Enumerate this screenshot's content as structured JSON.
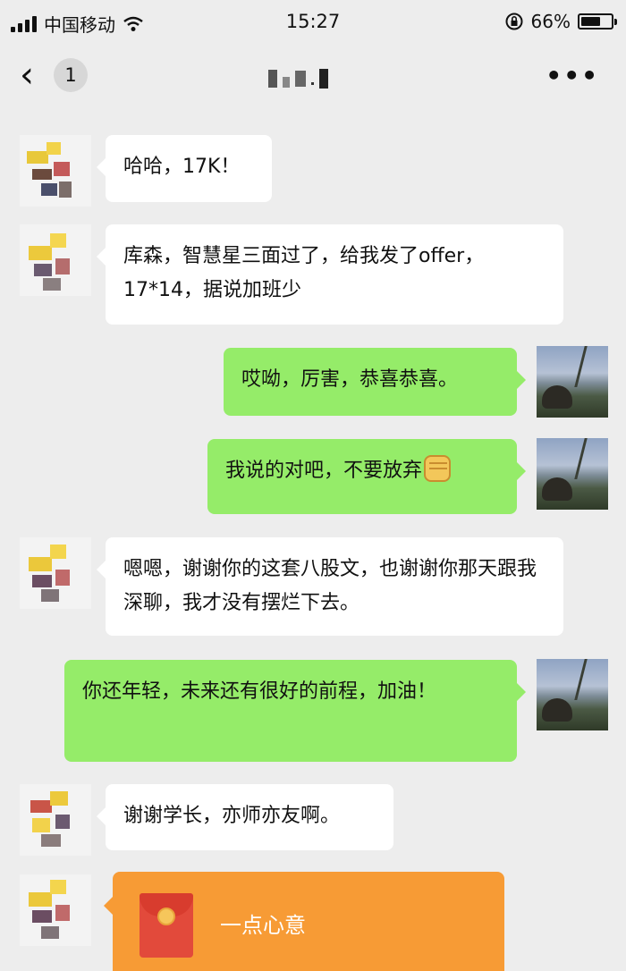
{
  "status_bar": {
    "carrier": "中国移动",
    "time": "15:27",
    "battery_text": "66%",
    "battery_level": 0.66,
    "icons": [
      "signal-icon",
      "wifi-icon",
      "rotation-lock-icon",
      "battery-icon"
    ]
  },
  "nav": {
    "back_icon": "chevron-left-icon",
    "unread_count": "1",
    "title": "",
    "more_icon": "more-dots-icon"
  },
  "messages": [
    {
      "sender": "them",
      "text": "哈哈，17K！"
    },
    {
      "sender": "them",
      "text": "库森，智慧星三面过了，给我发了offer，17*14，据说加班少"
    },
    {
      "sender": "me",
      "text": "哎呦，厉害，恭喜恭喜。"
    },
    {
      "sender": "me",
      "text": "我说的对吧，不要放弃",
      "emoji": "fist-emoji"
    },
    {
      "sender": "them",
      "text": "嗯嗯，谢谢你的这套八股文，也谢谢你那天跟我深聊，我才没有摆烂下去。"
    },
    {
      "sender": "me",
      "text": "你还年轻，未来还有很好的前程，加油！"
    },
    {
      "sender": "them",
      "text": "谢谢学长，亦师亦友啊。"
    }
  ],
  "red_packet": {
    "label": "一点心意",
    "icon": "red-envelope-icon",
    "color": "#f79b35"
  },
  "colors": {
    "background": "#ededed",
    "bubble_me": "#95ec69",
    "bubble_them": "#ffffff"
  }
}
